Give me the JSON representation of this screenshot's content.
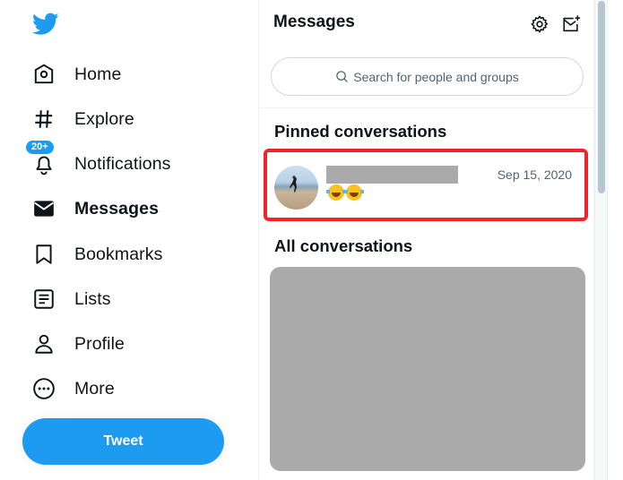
{
  "app": {
    "name": "Twitter",
    "brand_color": "#1d9bf0",
    "highlight_color": "#f4232b"
  },
  "sidebar": {
    "logo": "twitter-bird-icon",
    "items": [
      {
        "label": "Home",
        "icon": "home-icon",
        "active": false
      },
      {
        "label": "Explore",
        "icon": "hashtag-icon",
        "active": false
      },
      {
        "label": "Notifications",
        "icon": "bell-icon",
        "active": false,
        "badge": "20+"
      },
      {
        "label": "Messages",
        "icon": "envelope-icon",
        "active": true
      },
      {
        "label": "Bookmarks",
        "icon": "bookmark-icon",
        "active": false
      },
      {
        "label": "Lists",
        "icon": "list-icon",
        "active": false
      },
      {
        "label": "Profile",
        "icon": "person-icon",
        "active": false
      },
      {
        "label": "More",
        "icon": "more-circle-icon",
        "active": false
      }
    ],
    "tweet_button": "Tweet"
  },
  "messages": {
    "title": "Messages",
    "settings_icon": "gear-icon",
    "compose_icon": "new-message-icon",
    "search": {
      "placeholder": "Search for people and groups",
      "value": ""
    },
    "pinned_title": "Pinned conversations",
    "pinned": [
      {
        "name": "[redacted]",
        "date": "Sep 15, 2020",
        "preview": "😂😂",
        "highlighted": true
      }
    ],
    "all_title": "All conversations",
    "all_conversations_note": "[redacted]"
  }
}
